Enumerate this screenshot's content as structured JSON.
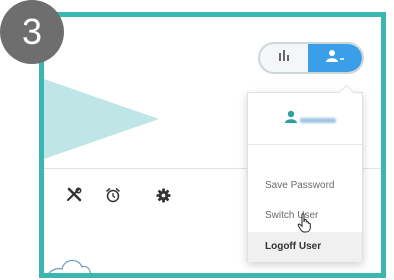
{
  "step": {
    "number": "3"
  },
  "header": {
    "view_toggle": {
      "chart_icon": "bar-chart-icon",
      "user_icon": "user-icon",
      "active": "user"
    }
  },
  "user_menu": {
    "user_icon": "user-icon",
    "items": [
      {
        "label": "Save Password",
        "active": false
      },
      {
        "label": "Switch User",
        "active": false
      },
      {
        "label": "Logoff User",
        "active": true
      }
    ]
  },
  "toolbar": {
    "icons": [
      "tools-icon",
      "alarm-clock-icon",
      "gear-icon"
    ]
  },
  "colors": {
    "frame": "#3bb6b0",
    "accent": "#3a9ee8",
    "banner": "#bfe6e6"
  }
}
